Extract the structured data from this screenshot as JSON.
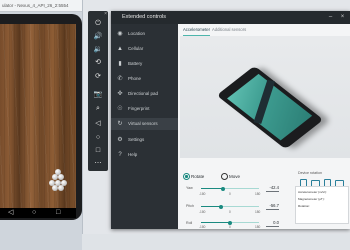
{
  "emulator": {
    "window_title": "ulator - Nexus_4_API_26_2:5554",
    "toolbar_icons": [
      "power-icon",
      "volume-up-icon",
      "volume-down-icon",
      "rotate-left-icon",
      "rotate-right-icon",
      "camera-icon",
      "zoom-icon",
      "back-icon",
      "home-icon",
      "overview-icon",
      "more-icon"
    ],
    "toolbar_glyphs": [
      "⏻",
      "🔊",
      "🔉",
      "⟲",
      "⟳",
      "📷",
      "⌕",
      "◁",
      "○",
      "□",
      "⋯"
    ],
    "close_glyph": "×",
    "nav_glyphs": {
      "back": "◁",
      "home": "○",
      "overview": "□"
    }
  },
  "extended_controls": {
    "title": "Extended controls",
    "window_buttons": {
      "minimize": "–",
      "close": "×"
    },
    "sidebar": [
      {
        "label": "Location",
        "icon": "location-icon",
        "glyph": "◉"
      },
      {
        "label": "Cellular",
        "icon": "cellular-icon",
        "glyph": "▲"
      },
      {
        "label": "Battery",
        "icon": "battery-icon",
        "glyph": "▮"
      },
      {
        "label": "Phone",
        "icon": "phone-icon",
        "glyph": "✆"
      },
      {
        "label": "Directional pad",
        "icon": "dpad-icon",
        "glyph": "✜"
      },
      {
        "label": "Fingerprint",
        "icon": "fingerprint-icon",
        "glyph": "☉"
      },
      {
        "label": "Virtual sensors",
        "icon": "sensors-icon",
        "glyph": "↻",
        "active": true
      },
      {
        "label": "Settings",
        "icon": "settings-icon",
        "glyph": "⚙"
      },
      {
        "label": "Help",
        "icon": "help-icon",
        "glyph": "?"
      }
    ],
    "tabs": [
      {
        "label": "Accelerometer",
        "selected": true
      },
      {
        "label": "Additional sensors",
        "selected": false
      }
    ],
    "mode": {
      "rotate": "Rotate",
      "move": "Move",
      "selected": "rotate"
    },
    "sliders": [
      {
        "label": "Yaw",
        "min": "-180",
        "mid": "0",
        "max": "180",
        "value": "-42.4",
        "fraction": 0.38
      },
      {
        "label": "Pitch",
        "min": "-180",
        "mid": "0",
        "max": "180",
        "value": "-56.7",
        "fraction": 0.34
      },
      {
        "label": "Roll",
        "min": "-180",
        "mid": "0",
        "max": "180",
        "value": "0.0",
        "fraction": 0.5
      }
    ],
    "device_rotation_label": "Device rotation",
    "resulting_values": {
      "title": "Resulting Values",
      "rows": [
        {
          "name": "Accelerometer (m/s²):",
          "value": ""
        },
        {
          "name": "Magnetometer (µT):",
          "value": ""
        },
        {
          "name": "Rotation:",
          "value": ""
        }
      ]
    }
  },
  "colors": {
    "accent": "#1a8a80",
    "dark_panel": "#2b3035"
  }
}
